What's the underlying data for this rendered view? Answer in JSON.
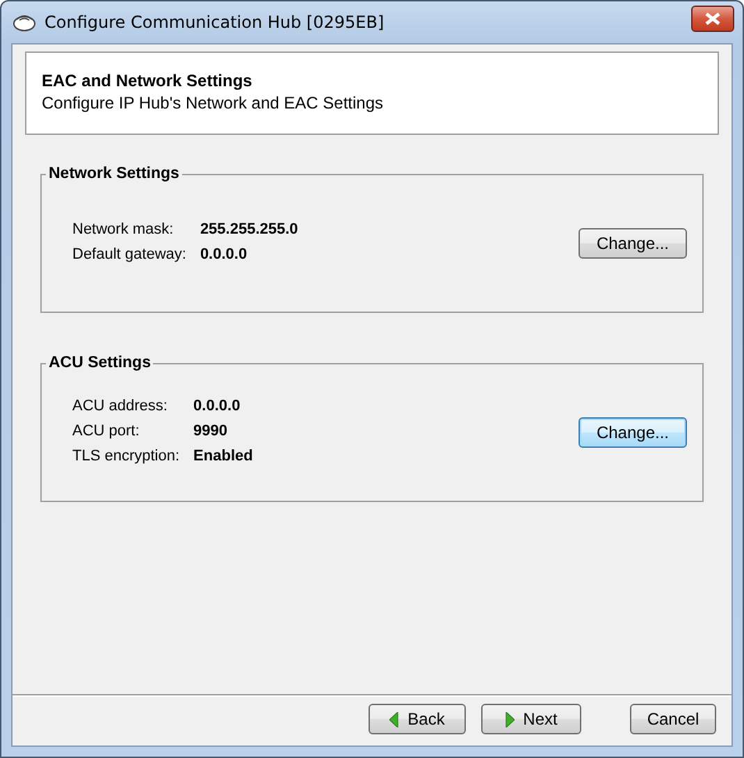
{
  "window": {
    "title": "Configure Communication Hub [0295EB]"
  },
  "header": {
    "title": "EAC and Network Settings",
    "subtitle": "Configure IP Hub's Network and EAC Settings"
  },
  "groups": [
    {
      "title": "Network Settings",
      "fields": [
        {
          "label": "Network mask:",
          "value": "255.255.255.0"
        },
        {
          "label": "Default gateway:",
          "value": "0.0.0.0"
        }
      ],
      "button": {
        "label": "Change...",
        "focused": false
      }
    },
    {
      "title": "ACU Settings",
      "fields": [
        {
          "label": "ACU address:",
          "value": "0.0.0.0"
        },
        {
          "label": "ACU port:",
          "value": "9990"
        },
        {
          "label": "TLS encryption:",
          "value": "Enabled"
        }
      ],
      "button": {
        "label": "Change...",
        "focused": true
      }
    }
  ],
  "footer": [
    {
      "kind": "back",
      "label": "Back"
    },
    {
      "kind": "next",
      "label": "Next"
    },
    {
      "kind": "cancel",
      "label": "Cancel"
    }
  ]
}
